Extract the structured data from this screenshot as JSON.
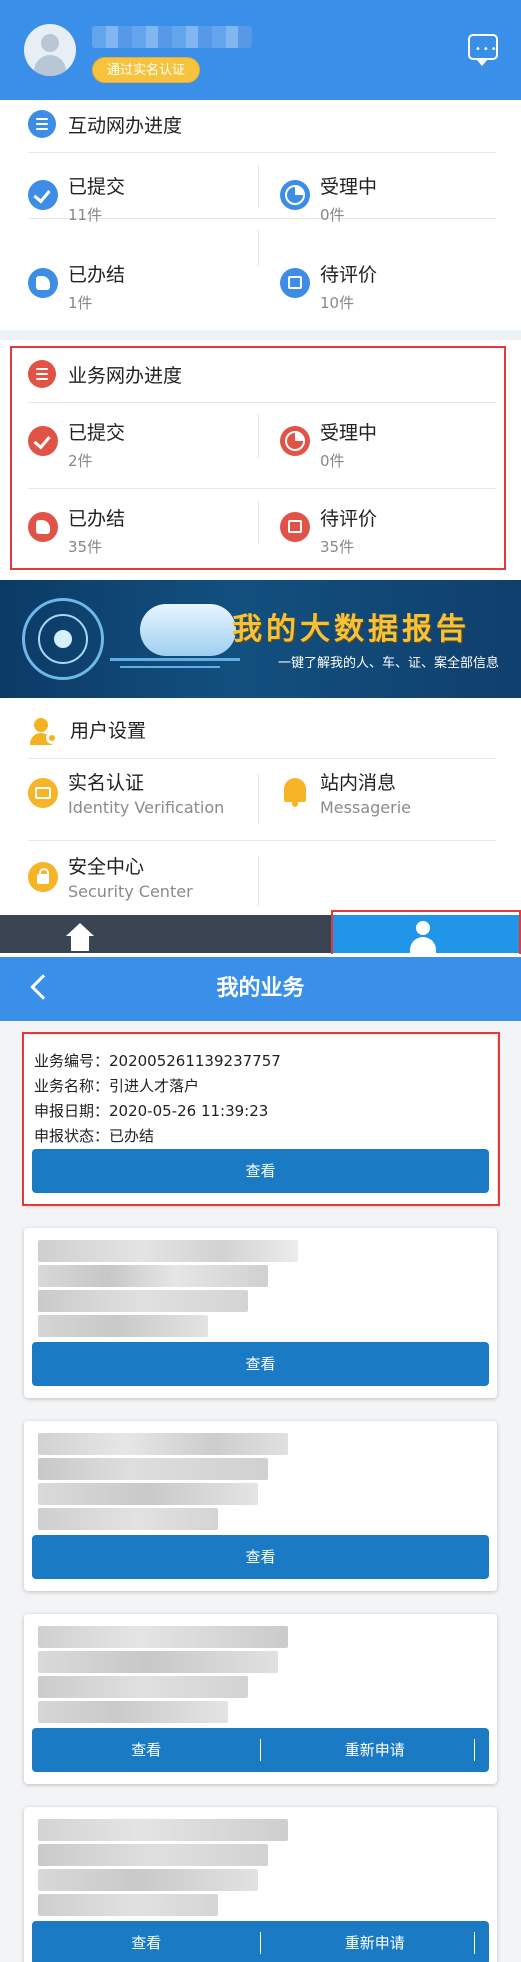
{
  "profile": {
    "verify_badge": "通过实名认证"
  },
  "interactive_progress": {
    "title": "互动网办进度",
    "items": [
      {
        "label": "已提交",
        "count": "11件"
      },
      {
        "label": "受理中",
        "count": "0件"
      },
      {
        "label": "已办结",
        "count": "1件"
      },
      {
        "label": "待评价",
        "count": "10件"
      }
    ]
  },
  "business_progress": {
    "title": "业务网办进度",
    "items": [
      {
        "label": "已提交",
        "count": "2件"
      },
      {
        "label": "受理中",
        "count": "0件"
      },
      {
        "label": "已办结",
        "count": "35件"
      },
      {
        "label": "待评价",
        "count": "35件"
      }
    ]
  },
  "banner": {
    "title": "我的大数据报告",
    "subtitle": "一键了解我的人、车、证、案全部信息"
  },
  "user_settings": {
    "title": "用户设置",
    "items": [
      {
        "title": "实名认证",
        "subtitle": "Identity Verification"
      },
      {
        "title": "站内消息",
        "subtitle": "Messagerie"
      },
      {
        "title": "安全中心",
        "subtitle": "Security Center"
      }
    ]
  },
  "my_business": {
    "title": "我的业务",
    "first_card": {
      "number": "业务编号：202005261139237757",
      "name": "业务名称：引进人才落户",
      "date": "申报日期：2020-05-26 11:39:23",
      "status": "申报状态：已办结"
    },
    "view_label": "查看",
    "reapply_label": "重新申请"
  },
  "colors": {
    "primary_blue": "#3a8fe8",
    "button_blue": "#1a7bc4",
    "accent_red": "#e05346",
    "accent_orange": "#f6b426",
    "highlight_border": "#e23a3a"
  }
}
